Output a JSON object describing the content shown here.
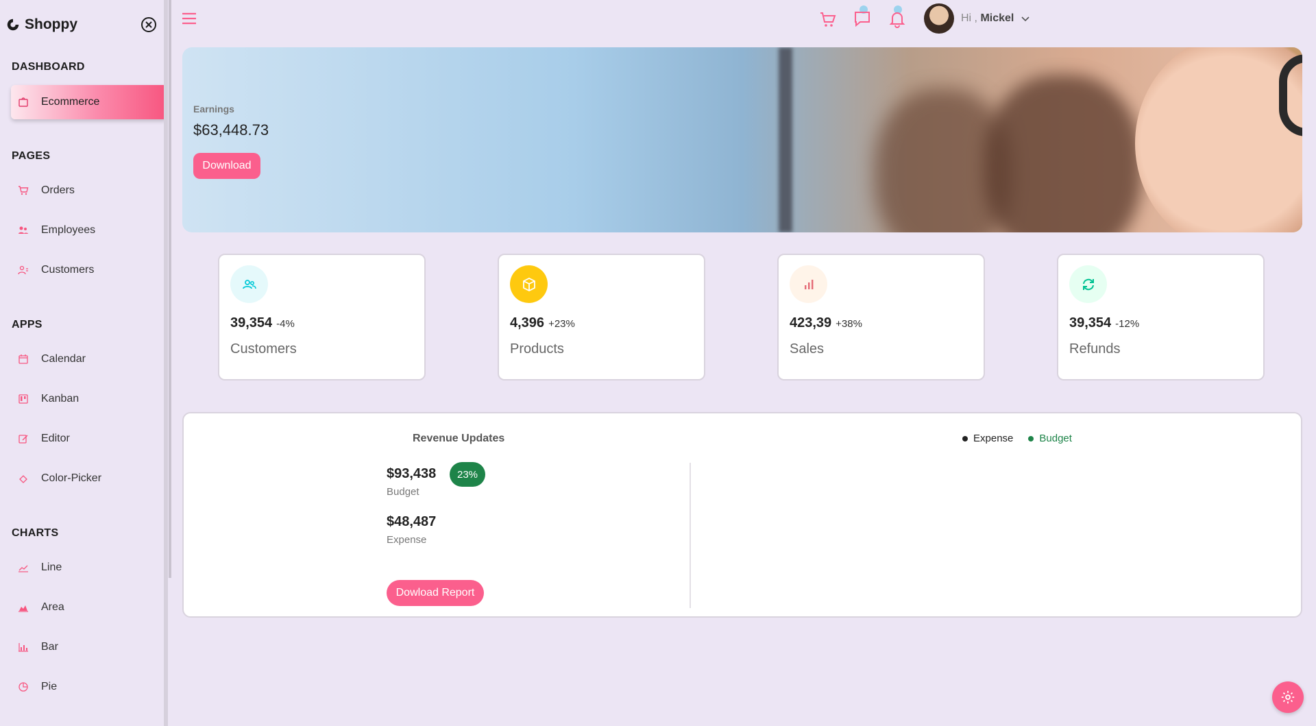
{
  "brand": {
    "name": "Shoppy"
  },
  "sidebar": {
    "sections": {
      "dashboard": "DASHBOARD",
      "pages": "PAGES",
      "apps": "APPS",
      "charts": "CHARTS"
    },
    "items": {
      "ecommerce": "Ecommerce",
      "orders": "Orders",
      "employees": "Employees",
      "customers": "Customers",
      "calendar": "Calendar",
      "kanban": "Kanban",
      "editor": "Editor",
      "color_picker": "Color-Picker",
      "line": "Line",
      "area": "Area",
      "bar": "Bar",
      "pie": "Pie"
    },
    "active": "ecommerce"
  },
  "topbar": {
    "greeting": "Hi ,",
    "user_name": "Mickel"
  },
  "hero": {
    "earnings_label": "Earnings",
    "earnings_value": "$63,448.73",
    "download_label": "Download"
  },
  "stats": [
    {
      "value": "39,354",
      "change": "-4%",
      "label": "Customers",
      "icon": "users-icon",
      "icon_bg": "#e5f9fb",
      "icon_color": "#03c9d7"
    },
    {
      "value": "4,396",
      "change": "+23%",
      "label": "Products",
      "icon": "box-icon",
      "icon_bg": "#fec90f",
      "icon_color": "#ffffff"
    },
    {
      "value": "423,39",
      "change": "+38%",
      "label": "Sales",
      "icon": "bar-chart-icon",
      "icon_bg": "#fff4e9",
      "icon_color": "#e46a76"
    },
    {
      "value": "39,354",
      "change": "-12%",
      "label": "Refunds",
      "icon": "refresh-icon",
      "icon_bg": "#e6fff2",
      "icon_color": "#00c292"
    }
  ],
  "revenue": {
    "title": "Revenue Updates",
    "legend": [
      {
        "name": "Expense",
        "color": "#222222"
      },
      {
        "name": "Budget",
        "color": "#1e8449"
      }
    ],
    "budget_amount": "$93,438",
    "budget_badge": "23%",
    "budget_label": "Budget",
    "expense_amount": "$48,487",
    "expense_label": "Expense",
    "report_button": "Dowload Report"
  },
  "colors": {
    "accent": "#fb5f8d",
    "background": "#ece5f4",
    "success": "#1e8449"
  }
}
